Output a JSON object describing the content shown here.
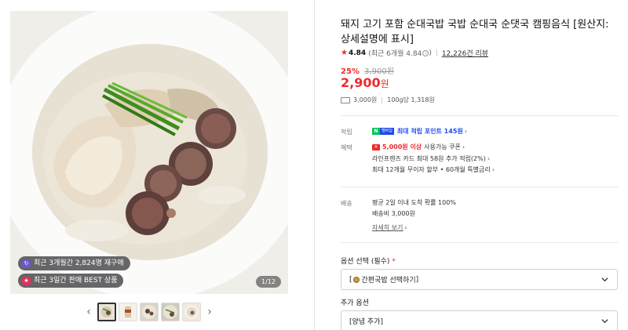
{
  "gallery": {
    "badge1": "최근 3개월간 2,824명 재구매",
    "badge2": "최근 3일간 판매 BEST 상품",
    "counter": "1/12",
    "thumb_count": 5
  },
  "product": {
    "title": "돼지 고기 포함 순대국밥 국밥 순대국 순댓국 캠핑음식 [원산지: 상세설명에 표시]",
    "rating": "4.84",
    "rating_detail": "(최근 6개월 4.84",
    "review_count": "12,226건 리뷰",
    "discount_rate": "25%",
    "original_price": "3,900원",
    "price": "2,900",
    "price_unit": "원",
    "shipping": "3,000원",
    "unit_price": "100g당 1,318원"
  },
  "benefits": {
    "point_label": "적립",
    "npay_n": "N",
    "npay_m": "멤버십",
    "point_text": "최대 적립 포인트 145원",
    "benefit_label": "혜택",
    "coupon_amount": "5,000원 이상",
    "coupon_text": "사용가능 쿠폰",
    "card_text": "라인프렌즈 카드 최대 58원 추가 적립(2%)",
    "installment_text": "최대 12개월 무이자 할부 • 60개월 특별금리"
  },
  "delivery": {
    "label": "배송",
    "line1": "평균 2일 이내 도착 확률 100%",
    "line2": "배송비 3,000원",
    "detail_link": "자세히 보기"
  },
  "options": {
    "required_label": "옵션 선택 (필수)",
    "required_star": "*",
    "required_value": "간편국밥 선택하기",
    "extra_label": "추가 옵션",
    "extra_value": "[양념 추가]"
  },
  "colors": {
    "accent_red": "#ef2b2a",
    "naver_green": "#03c75a",
    "point_blue": "#1f4df0"
  }
}
